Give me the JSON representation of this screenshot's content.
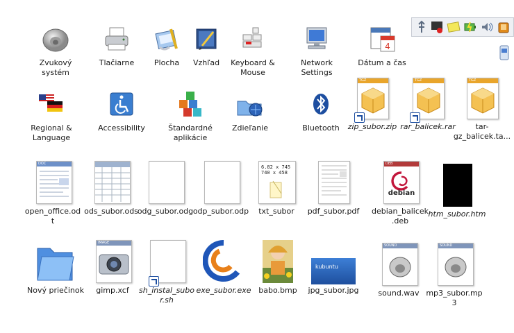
{
  "desktop_items": [
    {
      "id": "sound",
      "label": "Zvukový systém",
      "icon": "speaker-icon",
      "italic": false
    },
    {
      "id": "printers",
      "label": "Tlačiarne",
      "icon": "printer-icon",
      "italic": false
    },
    {
      "id": "desktop",
      "label": "Plocha",
      "icon": "desktop-icon",
      "italic": false
    },
    {
      "id": "appearance",
      "label": "Vzhľad",
      "icon": "appearance-icon",
      "italic": false
    },
    {
      "id": "keyboard",
      "label": "Keyboard & Mouse",
      "icon": "keyboard-mouse-icon",
      "italic": false
    },
    {
      "id": "network",
      "label": "Network Settings",
      "icon": "network-icon",
      "italic": false
    },
    {
      "id": "datetime",
      "label": "Dátum a čas",
      "icon": "calendar-icon",
      "italic": false
    },
    {
      "id": "regional",
      "label": "Regional & Language",
      "icon": "flags-icon",
      "italic": false
    },
    {
      "id": "accessibility",
      "label": "Accessibility",
      "icon": "accessibility-icon",
      "italic": false
    },
    {
      "id": "defaultapps",
      "label": "Štandardné aplikácie",
      "icon": "cubes-icon",
      "italic": false
    },
    {
      "id": "sharing",
      "label": "Zdieľanie",
      "icon": "sharing-icon",
      "italic": false
    },
    {
      "id": "bluetooth",
      "label": "Bluetooth",
      "icon": "bluetooth-icon",
      "italic": false
    },
    {
      "id": "zip",
      "label": "zip_subor.zip",
      "icon": "archive-icon",
      "italic": true,
      "tag": "TGZ",
      "link": true
    },
    {
      "id": "rar",
      "label": "rar_balicek.rar",
      "icon": "archive-icon",
      "italic": true,
      "tag": "TGZ",
      "link": true
    },
    {
      "id": "targz",
      "label": "tar-gz_balicek.ta...",
      "icon": "archive-icon",
      "italic": false,
      "tag": "TGZ",
      "link": false
    },
    {
      "id": "odt",
      "label": "open_office.odt",
      "icon": "document-icon",
      "italic": false,
      "tag": "DOC"
    },
    {
      "id": "ods",
      "label": "ods_subor.ods",
      "icon": "spreadsheet-icon",
      "italic": false
    },
    {
      "id": "odg",
      "label": "odg_subor.odg",
      "icon": "blank-file-icon",
      "italic": false
    },
    {
      "id": "odp",
      "label": "odp_subor.odp",
      "icon": "blank-file-icon",
      "italic": false
    },
    {
      "id": "txt",
      "label": "txt_subor",
      "icon": "text-file-icon",
      "italic": false,
      "preview": "6.82 x 745\n740 x 458"
    },
    {
      "id": "pdf",
      "label": "pdf_subor.pdf",
      "icon": "pdf-icon",
      "italic": false
    },
    {
      "id": "deb",
      "label": "debian_balicek.deb",
      "icon": "debian-icon",
      "italic": false,
      "tag": "DEB",
      "brand": "debian"
    },
    {
      "id": "htm",
      "label": "htm_subor.htm",
      "icon": "html-icon",
      "italic": true
    },
    {
      "id": "folder",
      "label": "Nový priečinok",
      "icon": "folder-icon",
      "italic": false
    },
    {
      "id": "xcf",
      "label": "gimp.xcf",
      "icon": "camera-icon",
      "italic": false,
      "tag": "IMAGE"
    },
    {
      "id": "sh",
      "label": "sh_instal_subor.sh",
      "icon": "blank-file-icon",
      "italic": true,
      "link": true
    },
    {
      "id": "exe",
      "label": "exe_subor.exe",
      "icon": "wine-icon",
      "italic": true
    },
    {
      "id": "bmp",
      "label": "babo.bmp",
      "icon": "photo-icon",
      "italic": false
    },
    {
      "id": "jpg",
      "label": "jpg_subor.jpg",
      "icon": "kubuntu-image-icon",
      "italic": false,
      "brand": "kubuntu"
    },
    {
      "id": "wav",
      "label": "sound.wav",
      "icon": "sound-file-icon",
      "italic": false,
      "tag": "SOUND"
    },
    {
      "id": "mp3",
      "label": "mp3_subor.mp3",
      "icon": "sound-file-icon",
      "italic": false,
      "tag": "SOUND"
    }
  ],
  "tray": {
    "items": [
      "usb-icon",
      "network-status-icon",
      "notes-icon",
      "battery-icon",
      "volume-icon",
      "clipboard-icon"
    ],
    "extra_icon": "storage-icon"
  },
  "colors": {
    "accent": "#1d4ea0",
    "tgz_tag": "#e9a52b",
    "doc_tag": "#6d90c8",
    "sound_tag": "#7f95ba",
    "deb_tag": "#b23a3a"
  }
}
